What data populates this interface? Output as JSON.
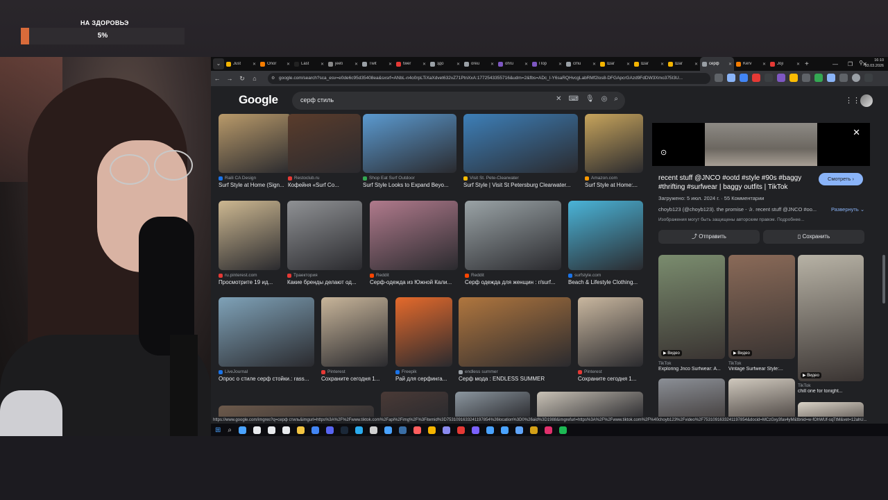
{
  "overlay": {
    "title": "НА ЗДОРОВЬЭ",
    "percent_text": "5%",
    "progress": 0.05,
    "bar_color": "#d96b3a"
  },
  "tabs": [
    {
      "label": "Just",
      "color": "#f4b400",
      "active": false
    },
    {
      "label": "Onor",
      "color": "#f57c00",
      "active": false
    },
    {
      "label": "Last",
      "color": "#222222",
      "active": false
    },
    {
      "label": "jeeti",
      "color": "#888888",
      "active": false
    },
    {
      "label": "Twit",
      "color": "#9aa0a6",
      "active": false
    },
    {
      "label": "twer",
      "color": "#e53935",
      "active": false
    },
    {
      "label": "здо",
      "color": "#9aa0a6",
      "active": false
    },
    {
      "label": "oreu",
      "color": "#9aa0a6",
      "active": false
    },
    {
      "label": "ohru",
      "color": "#7e57c2",
      "active": false
    },
    {
      "label": "Пор",
      "color": "#7e57c2",
      "active": false
    },
    {
      "label": "cmu",
      "color": "#9aa0a6",
      "active": false
    },
    {
      "label": "Шаг",
      "color": "#f4b400",
      "active": false
    },
    {
      "label": "Шаг",
      "color": "#f4b400",
      "active": false
    },
    {
      "label": "Шаг",
      "color": "#f4b400",
      "active": false
    },
    {
      "label": "серф",
      "color": "#9aa0a6",
      "active": true
    },
    {
      "label": "Kerv",
      "color": "#f57c00",
      "active": false
    },
    {
      "label": "Joji",
      "color": "#e53935",
      "active": false
    }
  ],
  "address": {
    "url": "google.com/search?sca_esv=e0de6c95d35408ea&sxsrf=ANbL-n4o0rpLTiXaXdvet632vZ71PtnXxA:1772543355716&udm=2&fbs=ADc_l-Y6saRQHvcgLabRMf2los8-DFGApcrGAzd9FdDW3Xmo375I3U..."
  },
  "google": {
    "logo": "Google",
    "query": "серф стиль"
  },
  "results": [
    {
      "source": "Raili CA Design",
      "title": "Surf Style at Home (Sign...",
      "color": "#b99a6a",
      "dot": "#1a73e8"
    },
    {
      "source": "Restoclub.ru",
      "title": "Кофейня «Surf Co...",
      "color": "#5a3c2c",
      "dot": "#e53935"
    },
    {
      "source": "Shop Eat Surf Outdoor",
      "title": "Surf Style Looks to Expand Beyo...",
      "color": "#5b9ad0",
      "dot": "#34a853"
    },
    {
      "source": "Visit St. Pete-Clearwater",
      "title": "Surf Style | Visit St Petersburg Clearwater...",
      "color": "#3d7fb8",
      "dot": "#fbbc04"
    },
    {
      "source": "Amazon.com",
      "title": "Surf Style at Home:...",
      "color": "#c7a45c",
      "dot": "#ff9900"
    },
    {
      "source": "ru.pinterest.com",
      "title": "Просмотрите 19 ид...",
      "color": "#cdb891",
      "dot": "#e53935"
    },
    {
      "source": "Траектория",
      "title": "Какие бренды делают од...",
      "color": "#8f9194",
      "dot": "#e53935"
    },
    {
      "source": "Reddit",
      "title": "Серф-одежда из Южной Кали...",
      "color": "#b07a8c",
      "dot": "#ff4500"
    },
    {
      "source": "Reddit",
      "title": "Серф одежда для женщин : r/surf...",
      "color": "#9aa3a6",
      "dot": "#ff4500"
    },
    {
      "source": "surfstyle.com",
      "title": "Beach & Lifestyle Clothing...",
      "color": "#4ab4d8",
      "dot": "#1a73e8"
    },
    {
      "source": "LiveJournal",
      "title": "Опрос о стиле серф стойки.: rass...",
      "color": "#7fa2b8",
      "dot": "#1a73e8"
    },
    {
      "source": "Pinterest",
      "title": "Сохраните сегодня 1...",
      "color": "#c8b59a",
      "dot": "#e53935"
    },
    {
      "source": "Freepik",
      "title": "Рай для серфинга...",
      "color": "#e56a2c",
      "dot": "#1a73e8"
    },
    {
      "source": "endless summer",
      "title": "Серф мода : ENDLESS SUMMER",
      "color": "#b0763e",
      "dot": "#9aa0a6"
    },
    {
      "source": "Pinterest",
      "title": "Сохраните сегодня 1...",
      "color": "#c9b79f",
      "dot": "#e53935"
    },
    {
      "source": "",
      "title": "",
      "color": "#6d5a4b",
      "dot": "#000000"
    },
    {
      "source": "",
      "title": "",
      "color": "#4a3a36",
      "dot": "#000000"
    },
    {
      "source": "",
      "title": "",
      "color": "#8c97a0",
      "dot": "#000000"
    },
    {
      "source": "",
      "title": "",
      "color": "#c9c2b6",
      "dot": "#000000"
    }
  ],
  "panel": {
    "title": "recent stuff @JNCO #ootd #style #90s #baggy #thrifting #surfwear | baggy outfits | TikTok",
    "visit_label": "Смотреть",
    "meta": "Загружено: 5 июл. 2024 г. · 55 Комментарии",
    "desc": "choyb123 (@choyb123). the promise - ✰. recent stuff @JNCO #oo...",
    "expand_label": "Развернуть",
    "copyright": "Изображения могут быть защищены авторским правом. Подробнее...",
    "share_label": "Отправить",
    "save_label": "Сохранить",
    "related": [
      {
        "badge": "Видео",
        "source": "TikTok",
        "title": "Exploring Jnco Surfwear: A...",
        "color": "#7a8c6e"
      },
      {
        "badge": "Видео",
        "source": "TikTok",
        "title": "Vintage Surfwear Style:...",
        "color": "#8a6a58"
      },
      {
        "badge": "Видео",
        "source": "TikTok",
        "title": "chill one for tonight...",
        "color": "#b7b2a5"
      },
      {
        "badge": "",
        "source": "",
        "title": "",
        "color": "#8b8f96"
      },
      {
        "badge": "",
        "source": "",
        "title": "",
        "color": "#cfc8bd"
      },
      {
        "badge": "",
        "source": "",
        "title": "",
        "color": "#d9d2c6"
      }
    ]
  },
  "status_url": "https://www.google.com/imgres?q=серф стиль&imgurl=https%3A%2F%2Fwww.tiktok.com%2Fapi%2Fimg%2F%3Fitemid%3D7531091633241197854%26location%3D0%26aid%3D1988&imgrefurl=https%3A%2F%2Fwww.tiktok.com%2F%40choyb123%2Fvideo%2F7531091633241197854&docid=MCzGxy3fav4yM&tbnid=w-fOhWUf-sqTtM&vet=12ahU...",
  "taskbar": {
    "time": "16:10",
    "date": "03.03.2026",
    "icons": [
      "#4aa3ff",
      "#e8eaed",
      "#e8eaed",
      "#e8eaed",
      "#f4c542",
      "#4285f4",
      "#5865f2",
      "#1b2838",
      "#2aabee",
      "#d0d0d0",
      "#4aa3ff",
      "#3a6ea5",
      "#ff5e5e",
      "#f4b400",
      "#8a8af0",
      "#e53935",
      "#7b61ff",
      "#4aa3ff",
      "#4aa3ff",
      "#60a5fa",
      "#d4a017",
      "#e1306c",
      "#1db954"
    ]
  }
}
